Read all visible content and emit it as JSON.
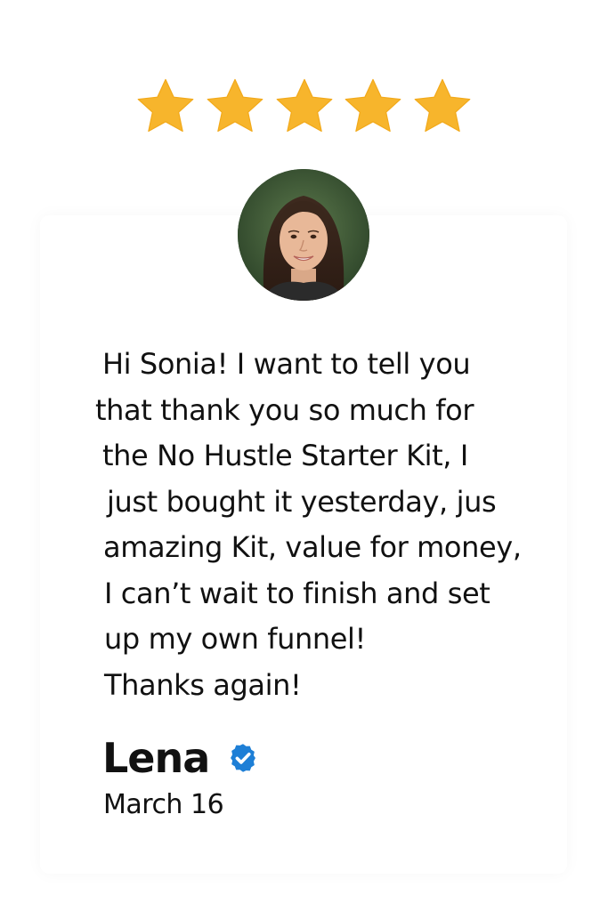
{
  "rating": {
    "stars_filled": 5,
    "stars_total": 5,
    "star_color": "#F7B52C"
  },
  "avatar": {
    "icon": "reviewer-photo"
  },
  "review": {
    "lines": [
      "Hi Sonia! I want to tell you",
      "that thank you so much for",
      "the No Hustle Starter Kit, I",
      "just bought it yesterday, jus",
      "amazing Kit, value for money,",
      "I can’t wait to finish and set",
      "up my own funnel!",
      "Thanks again!"
    ]
  },
  "author": {
    "name": "Lena",
    "verified": true,
    "verified_icon": "verified-badge-icon",
    "verified_color": "#1E7FD6",
    "date": "March 16"
  }
}
